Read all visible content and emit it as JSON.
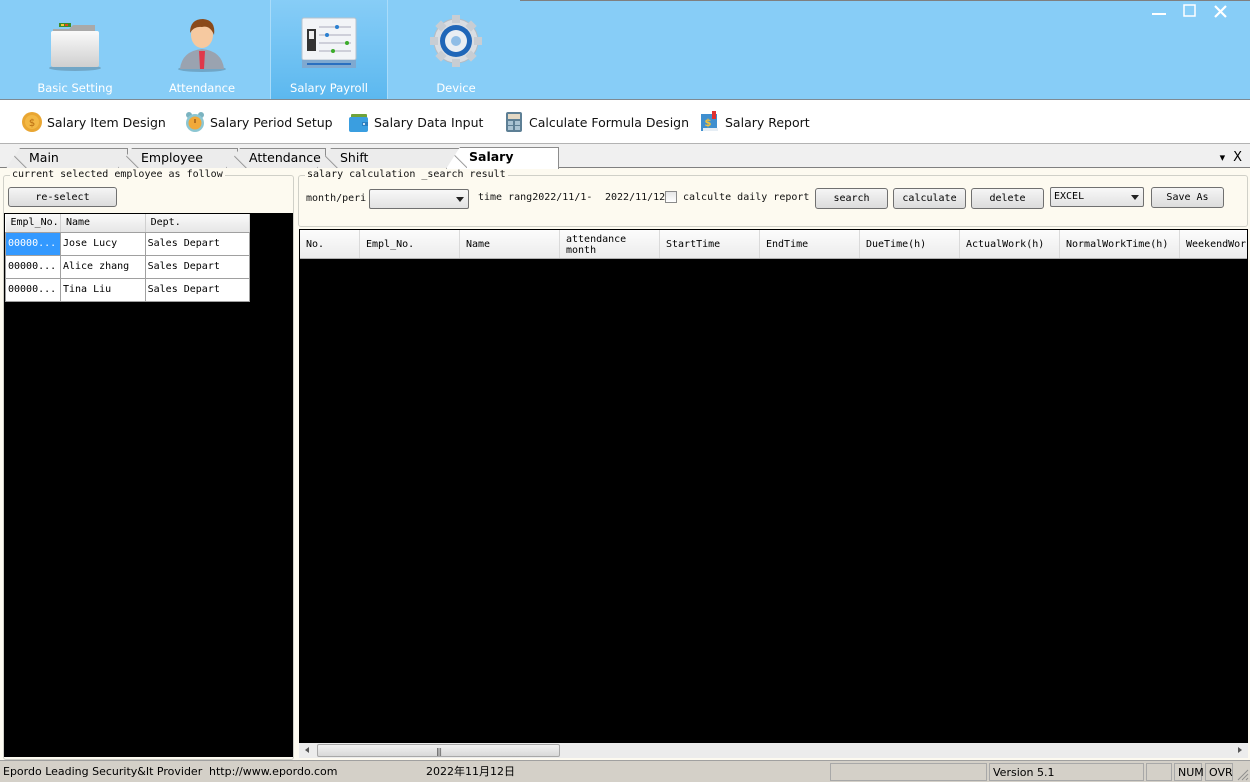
{
  "window": {
    "controls": [
      "minimize",
      "maximize",
      "close"
    ]
  },
  "modules": [
    {
      "label": "Basic Setting",
      "icon": "folder-icon",
      "active": false
    },
    {
      "label": "Attendance",
      "icon": "person-icon",
      "active": false
    },
    {
      "label": "Salary Payroll",
      "icon": "payroll-panel-icon",
      "active": true
    },
    {
      "label": "Device",
      "icon": "gear-icon",
      "active": false
    }
  ],
  "toolbar": [
    {
      "label": "Salary Item Design",
      "icon": "coin-icon"
    },
    {
      "label": "Salary Period Setup",
      "icon": "alarm-clock-icon"
    },
    {
      "label": "Salary Data Input",
      "icon": "wallet-icon"
    },
    {
      "label": "Calculate Formula Design",
      "icon": "calculator-icon"
    },
    {
      "label": "Salary Report",
      "icon": "report-book-icon"
    }
  ],
  "tabs": [
    {
      "label": "Main Interface",
      "active": false
    },
    {
      "label": "Employee Info",
      "active": false
    },
    {
      "label": "Attendance",
      "active": false
    },
    {
      "label": "Shift management",
      "active": false
    },
    {
      "label": "Salary Report",
      "active": true
    }
  ],
  "tab_controls": {
    "dropdown": "▾",
    "close": "X"
  },
  "left_panel": {
    "legend": "current selected employee as follow",
    "reselect_label": "re-select",
    "columns": [
      "Empl_No.",
      "Name",
      "Dept."
    ],
    "rows": [
      {
        "empl_no": "00000...",
        "name": "Jose Lucy",
        "dept": "Sales Depart",
        "selected": true
      },
      {
        "empl_no": "00000...",
        "name": "Alice zhang",
        "dept": "Sales Depart",
        "selected": false
      },
      {
        "empl_no": "00000...",
        "name": "Tina Liu",
        "dept": "Sales Depart",
        "selected": false
      }
    ]
  },
  "right_panel": {
    "legend": "salary calculation _search result",
    "period_label": "month/peri",
    "period_value": "",
    "time_range_label": "time rang",
    "time_from": "2022/11/1",
    "time_sep": "-",
    "time_to": "2022/11/12",
    "daily_report_label": "calculte daily report",
    "daily_report_checked": false,
    "search_label": "search",
    "calculate_label": "calculate",
    "delete_label": "delete",
    "export_format": "EXCEL",
    "save_as_label": "Save As",
    "columns": [
      "No.",
      "Empl_No.",
      "Name",
      "attendance\nmonth",
      "StartTime",
      "EndTime",
      "DueTime(h)",
      "ActualWork(h)",
      "NormalWorkTime(h)",
      "WeekendWork"
    ],
    "rows": []
  },
  "statusbar": {
    "company": "Epordo Leading Security&It Provider",
    "url": "http://www.epordo.com",
    "date": "2022年11月12日",
    "version": "Version 5.1",
    "num": "NUM",
    "ovr": "OVR"
  }
}
